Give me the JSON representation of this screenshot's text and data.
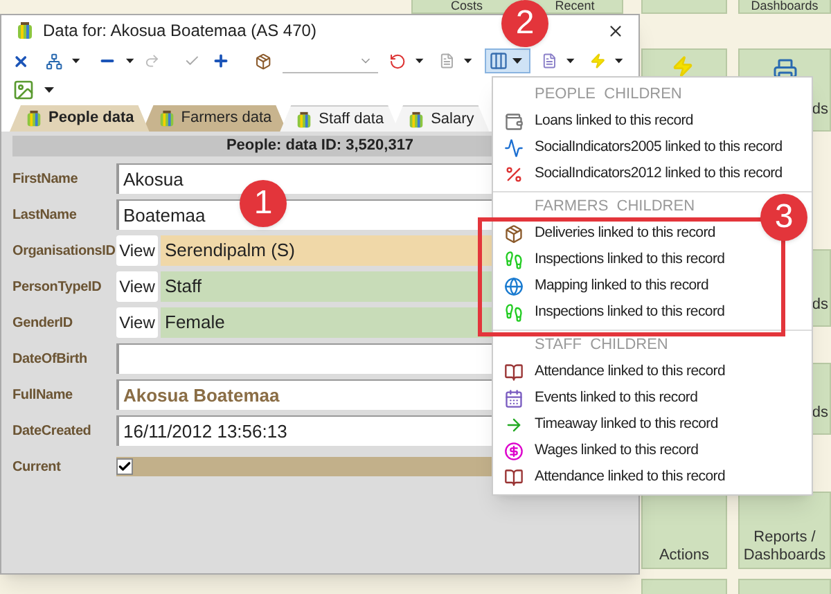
{
  "background_tiles": [
    {
      "label": "Costs"
    },
    {
      "label": "Recent"
    },
    {
      "label": "Dashboards"
    },
    {
      "label": "ds"
    },
    {
      "label": "ds"
    },
    {
      "label": "ds"
    },
    {
      "label": "Actions"
    },
    {
      "label": "Reports / Dashboards"
    }
  ],
  "window": {
    "title": "Data for: Akosua Boatemaa (AS 470)"
  },
  "tabs": [
    {
      "label": "People data",
      "selected": true
    },
    {
      "label": "Farmers data",
      "selected": false
    },
    {
      "label": "Staff data",
      "selected": false
    },
    {
      "label": "Salary",
      "selected": false
    }
  ],
  "header": "People: data ID: 3,520,317",
  "fields": [
    {
      "label": "FirstName",
      "kind": "text",
      "value": "Akosua"
    },
    {
      "label": "LastName",
      "kind": "text",
      "value": "Boatemaa"
    },
    {
      "label": "OrganisationsID",
      "kind": "lookup",
      "button": "View",
      "value": "Serendipalm (S)",
      "color": "#f0d8a8"
    },
    {
      "label": "PersonTypeID",
      "kind": "lookup",
      "button": "View",
      "value": "Staff",
      "color": "#c8dcb8"
    },
    {
      "label": "GenderID",
      "kind": "lookup",
      "button": "View",
      "value": "Female",
      "color": "#c8dcb8"
    },
    {
      "label": "DateOfBirth",
      "kind": "text"
    },
    {
      "label": "FullName",
      "kind": "calculated",
      "value": "Akosua Boatemaa"
    },
    {
      "label": "DateCreated",
      "kind": "text",
      "value": "16/11/2012 13:56:13"
    },
    {
      "label": "Current",
      "kind": "checkbox",
      "checked": true
    }
  ],
  "menu": {
    "groups": [
      {
        "heading": "PEOPLE  CHILDREN",
        "items": [
          "Loans linked to this record",
          "SocialIndicators2005 linked to this record",
          "SocialIndicators2012 linked to this record"
        ]
      },
      {
        "heading": "FARMERS  CHILDREN",
        "highlighted": true,
        "items": [
          "Deliveries linked to this record",
          "Inspections linked to this record",
          "Mapping linked to this record",
          "Inspections linked to this record"
        ]
      },
      {
        "heading": "STAFF  CHILDREN",
        "items": [
          "Attendance linked to this record",
          "Events linked to this record",
          "Timeaway linked to this record",
          "Wages linked to this record",
          "Attendance linked to this record"
        ]
      }
    ]
  },
  "callouts": [
    "1",
    "2",
    "3"
  ]
}
